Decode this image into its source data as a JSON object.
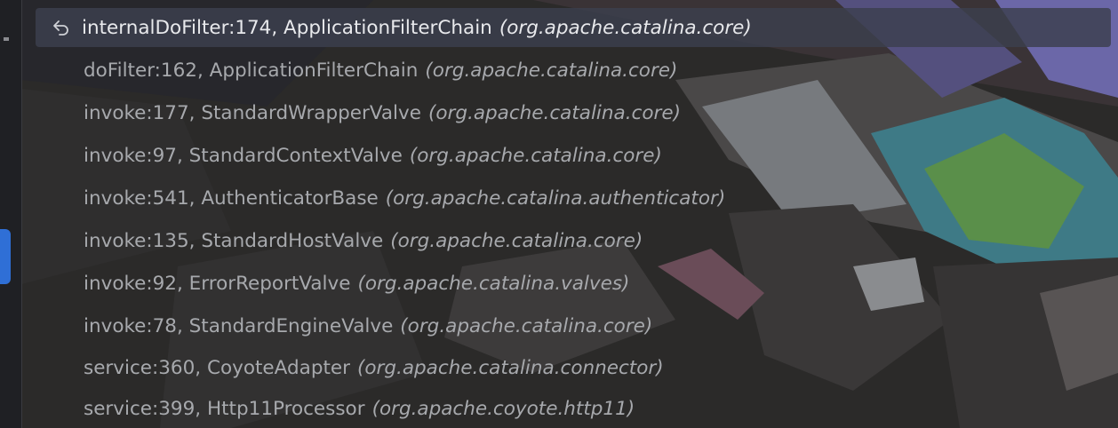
{
  "frames": [
    {
      "method": "internalDoFilter:174, ApplicationFilterChain",
      "package": "(org.apache.catalina.core)",
      "selected": true,
      "icon": "return-arrow-icon"
    },
    {
      "method": "doFilter:162, ApplicationFilterChain",
      "package": "(org.apache.catalina.core)"
    },
    {
      "method": "invoke:177, StandardWrapperValve",
      "package": "(org.apache.catalina.core)"
    },
    {
      "method": "invoke:97, StandardContextValve",
      "package": "(org.apache.catalina.core)"
    },
    {
      "method": "invoke:541, AuthenticatorBase",
      "package": "(org.apache.catalina.authenticator)"
    },
    {
      "method": "invoke:135, StandardHostValve",
      "package": "(org.apache.catalina.core)"
    },
    {
      "method": "invoke:92, ErrorReportValve",
      "package": "(org.apache.catalina.valves)"
    },
    {
      "method": "invoke:78, StandardEngineValve",
      "package": "(org.apache.catalina.core)"
    },
    {
      "method": "service:360, CoyoteAdapter",
      "package": "(org.apache.catalina.connector)"
    },
    {
      "method": "service:399, Http11Processor",
      "package": "(org.apache.coyote.http11)"
    }
  ],
  "colors": {
    "selected_text": "#e8e9ec",
    "frame_text": "#a7a9ad",
    "accent_tab": "#2f6fd6"
  }
}
